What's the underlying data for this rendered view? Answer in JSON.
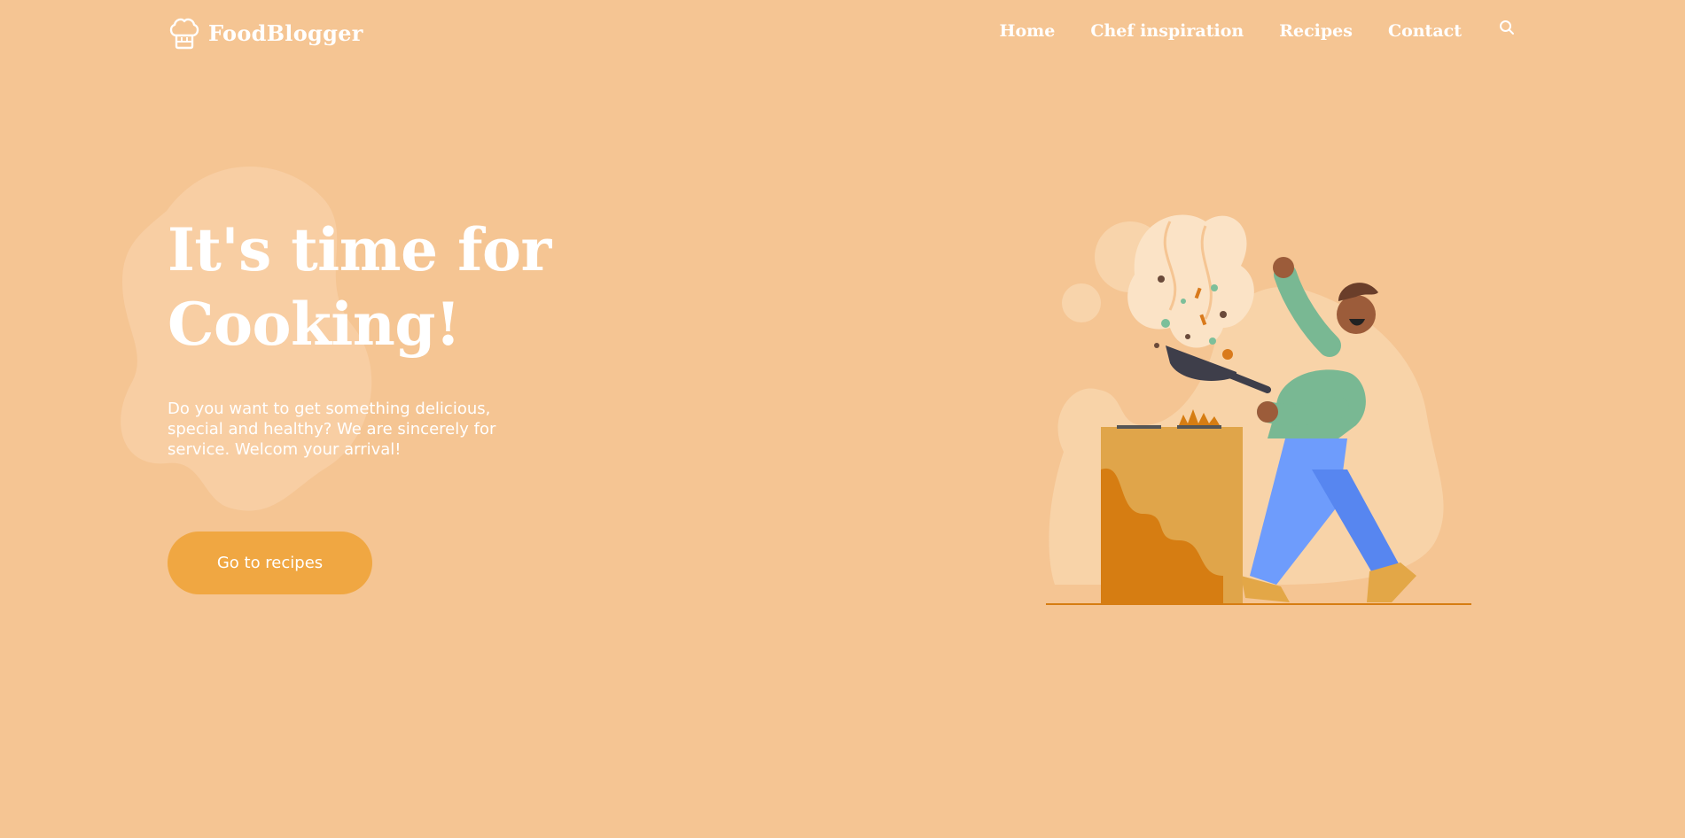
{
  "header": {
    "brand": "FoodBlogger",
    "logo_icon": "chef-hat-icon",
    "nav": [
      {
        "label": "Home"
      },
      {
        "label": "Chef inspiration"
      },
      {
        "label": "Recipes"
      },
      {
        "label": "Contact"
      }
    ],
    "search_icon": "search-icon"
  },
  "hero": {
    "title_line1": "It's time for",
    "title_line2": "Cooking!",
    "description": "Do you want to get something delicious, special and healthy? We are sincerely for service. Welcom your arrival!",
    "cta_label": "Go to recipes"
  },
  "illustration": {
    "subject": "chef-tossing-pan-illustration"
  },
  "colors": {
    "background": "#f5c593",
    "accent": "#f0a742",
    "text": "#ffffff"
  }
}
